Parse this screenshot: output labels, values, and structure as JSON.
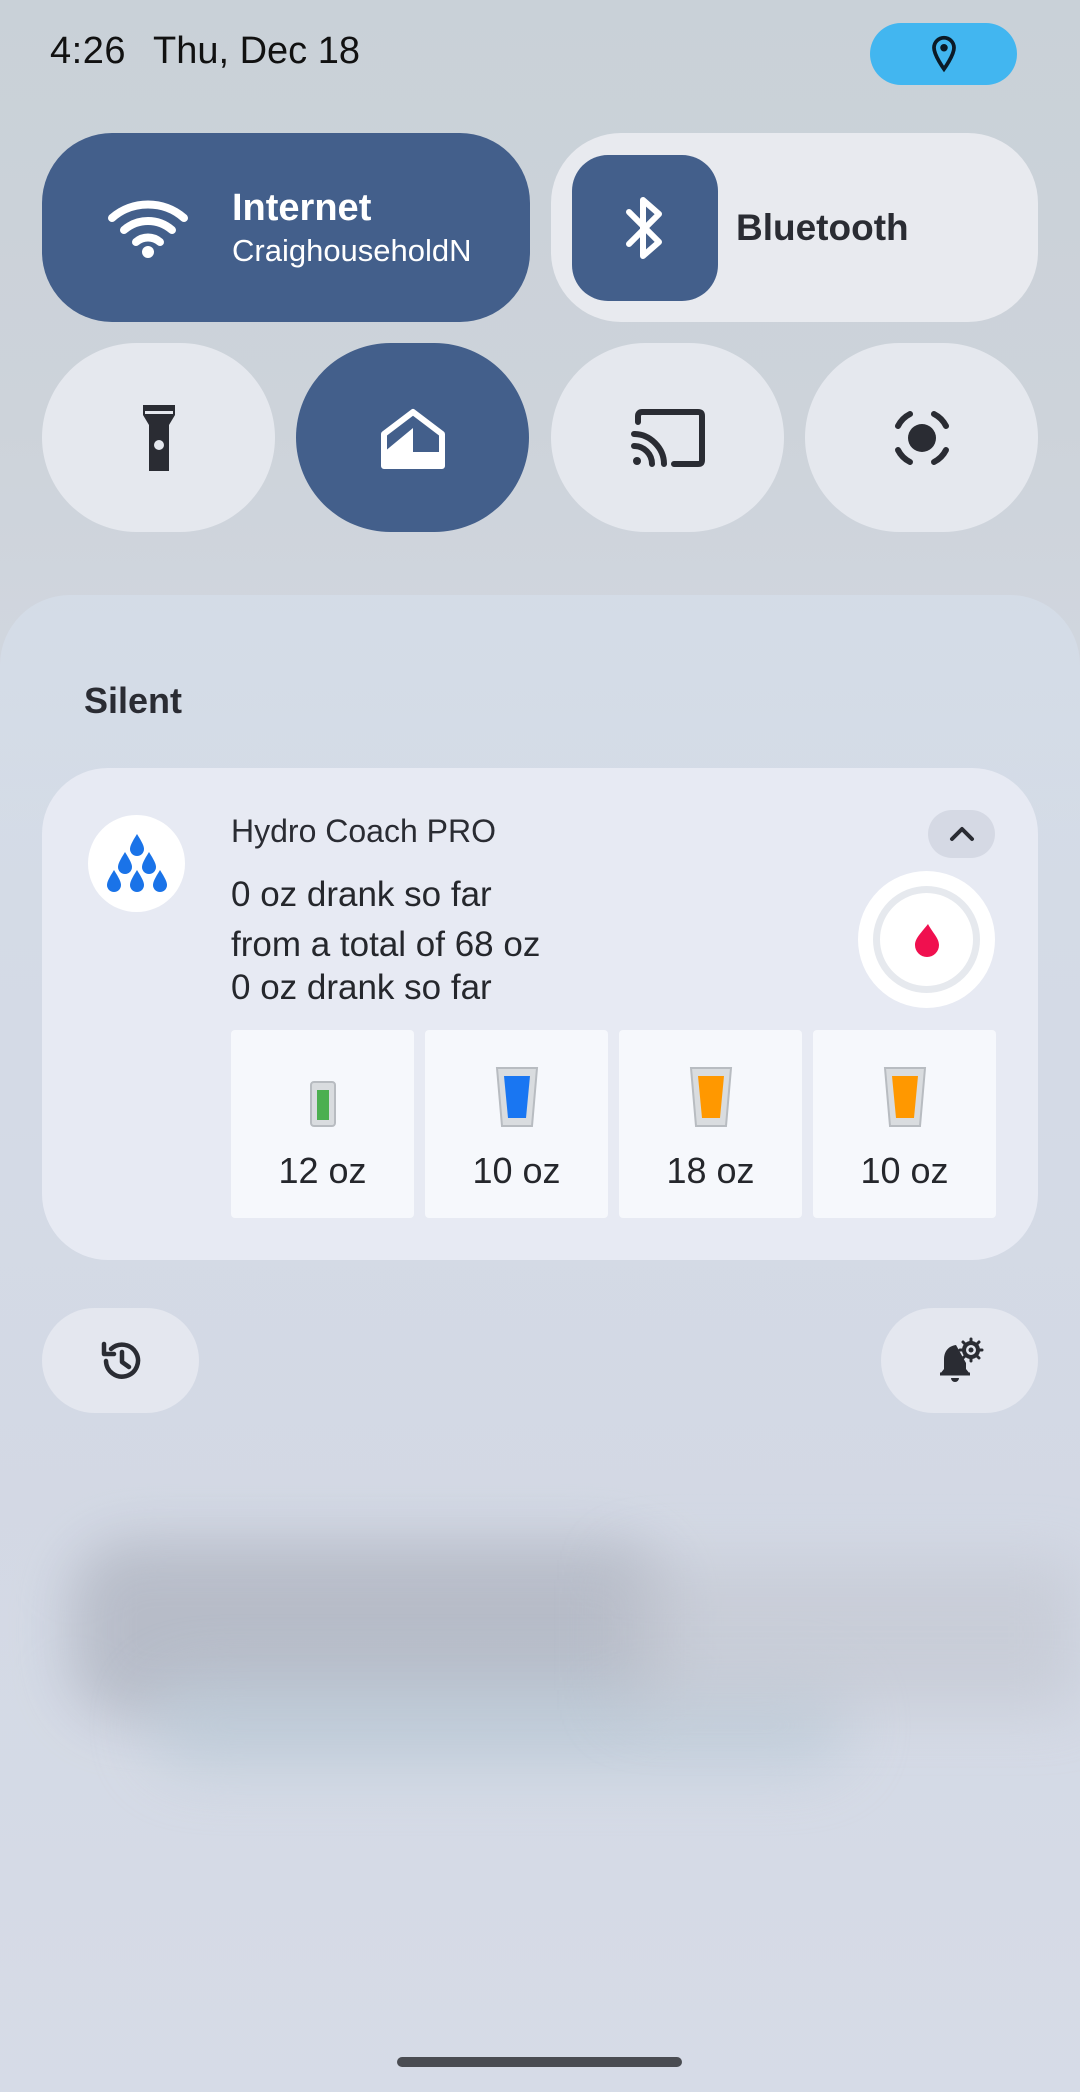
{
  "status_bar": {
    "time": "4:26",
    "date": "Thu, Dec 18",
    "location_icon": "location-pin-icon",
    "chip_color": "#42b6f0"
  },
  "quick_settings": {
    "internet": {
      "title": "Internet",
      "subtitle": "CraighouseholdN",
      "icon": "wifi-icon",
      "active": true
    },
    "bluetooth": {
      "title": "Bluetooth",
      "icon": "bluetooth-icon",
      "active": true
    },
    "tiles": [
      {
        "name": "flashlight",
        "icon": "flashlight-icon",
        "active": false
      },
      {
        "name": "home",
        "icon": "home-icon",
        "active": true
      },
      {
        "name": "cast",
        "icon": "cast-icon",
        "active": false
      },
      {
        "name": "screen-record",
        "icon": "screen-record-icon",
        "active": false
      }
    ],
    "accent_color": "#435f8b"
  },
  "notifications": {
    "section_label": "Silent",
    "hydro": {
      "app_name": "Hydro Coach PRO",
      "line1": "0 oz drank so far",
      "line2": "from a total of 68 oz",
      "line3": "0 oz drank so far",
      "progress": 0,
      "drink_buttons": [
        {
          "label": "12 oz",
          "color": "#4caf50",
          "icon": "glass-icon"
        },
        {
          "label": "10 oz",
          "color": "#1976f2",
          "icon": "cup-icon"
        },
        {
          "label": "18 oz",
          "color": "#ff9800",
          "icon": "cup-icon"
        },
        {
          "label": "10 oz",
          "color": "#ff9800",
          "icon": "cup-icon"
        }
      ]
    }
  },
  "footer_buttons": {
    "history_icon": "history-icon",
    "settings_icon": "notification-settings-icon"
  }
}
